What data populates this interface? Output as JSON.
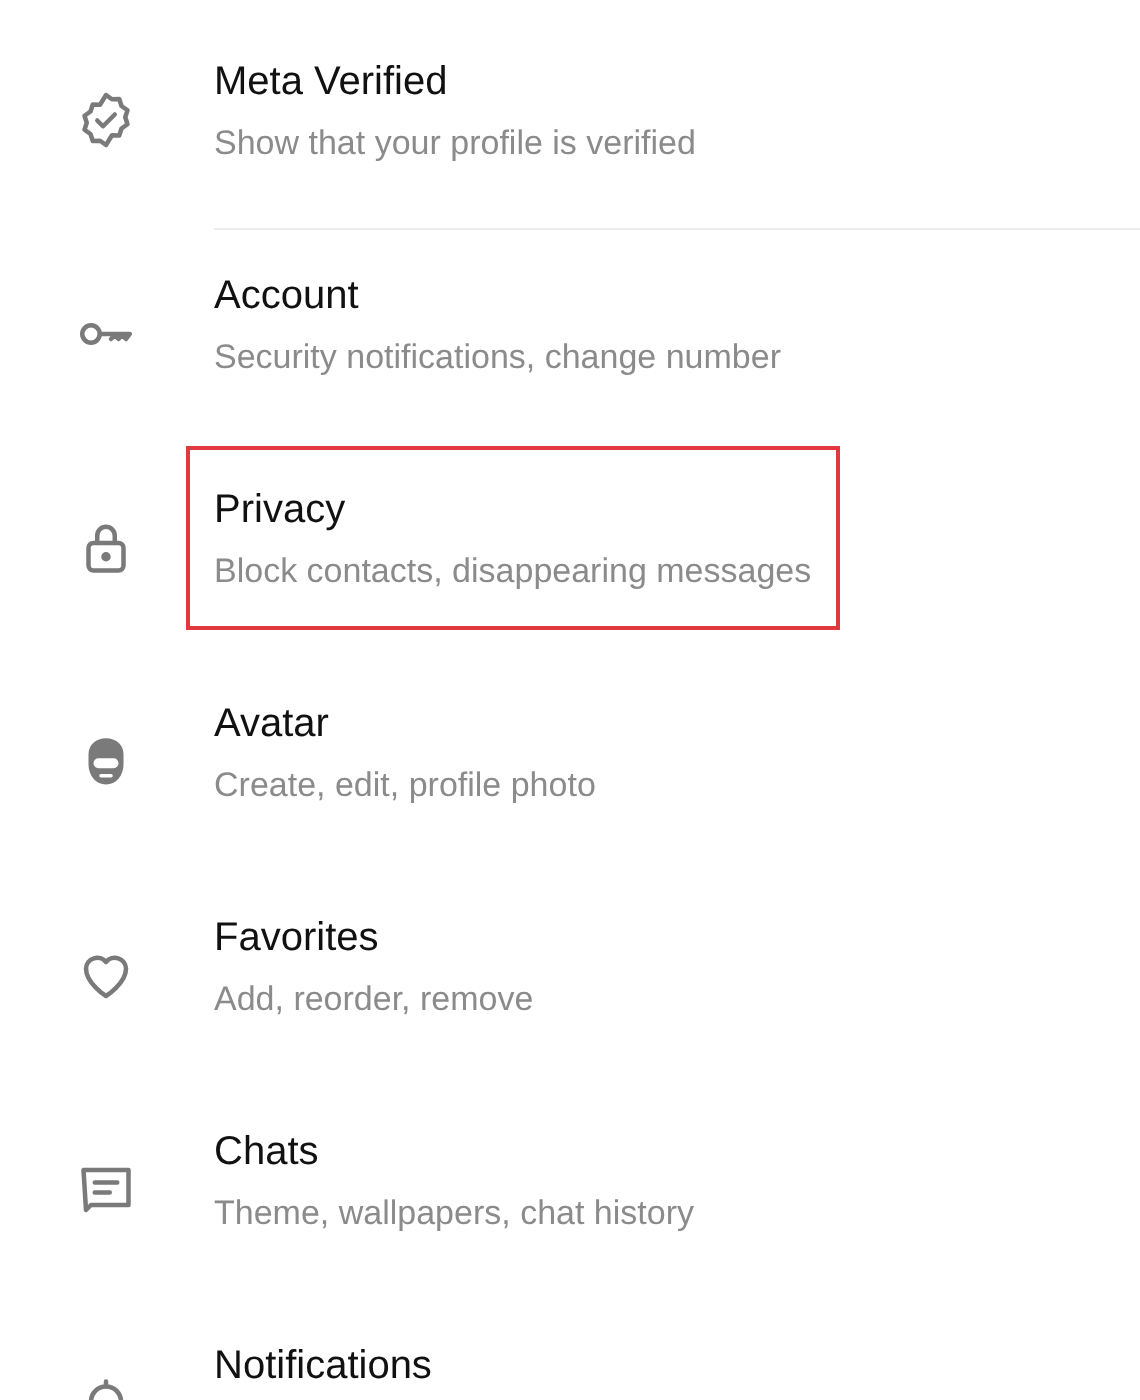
{
  "settings": [
    {
      "kind": "verified",
      "title": "Meta Verified",
      "subtitle": "Show that your profile is verified",
      "divider": true,
      "highlighted": false
    },
    {
      "kind": "key",
      "title": "Account",
      "subtitle": "Security notifications, change number",
      "divider": false,
      "highlighted": false
    },
    {
      "kind": "lock",
      "title": "Privacy",
      "subtitle": "Block contacts, disappearing messages",
      "divider": false,
      "highlighted": true
    },
    {
      "kind": "avatar",
      "title": "Avatar",
      "subtitle": "Create, edit, profile photo",
      "divider": false,
      "highlighted": false
    },
    {
      "kind": "heart",
      "title": "Favorites",
      "subtitle": "Add, reorder, remove",
      "divider": false,
      "highlighted": false
    },
    {
      "kind": "chat",
      "title": "Chats",
      "subtitle": "Theme, wallpapers, chat history",
      "divider": false,
      "highlighted": false
    },
    {
      "kind": "bell",
      "title": "Notifications",
      "highlighted": false
    }
  ]
}
